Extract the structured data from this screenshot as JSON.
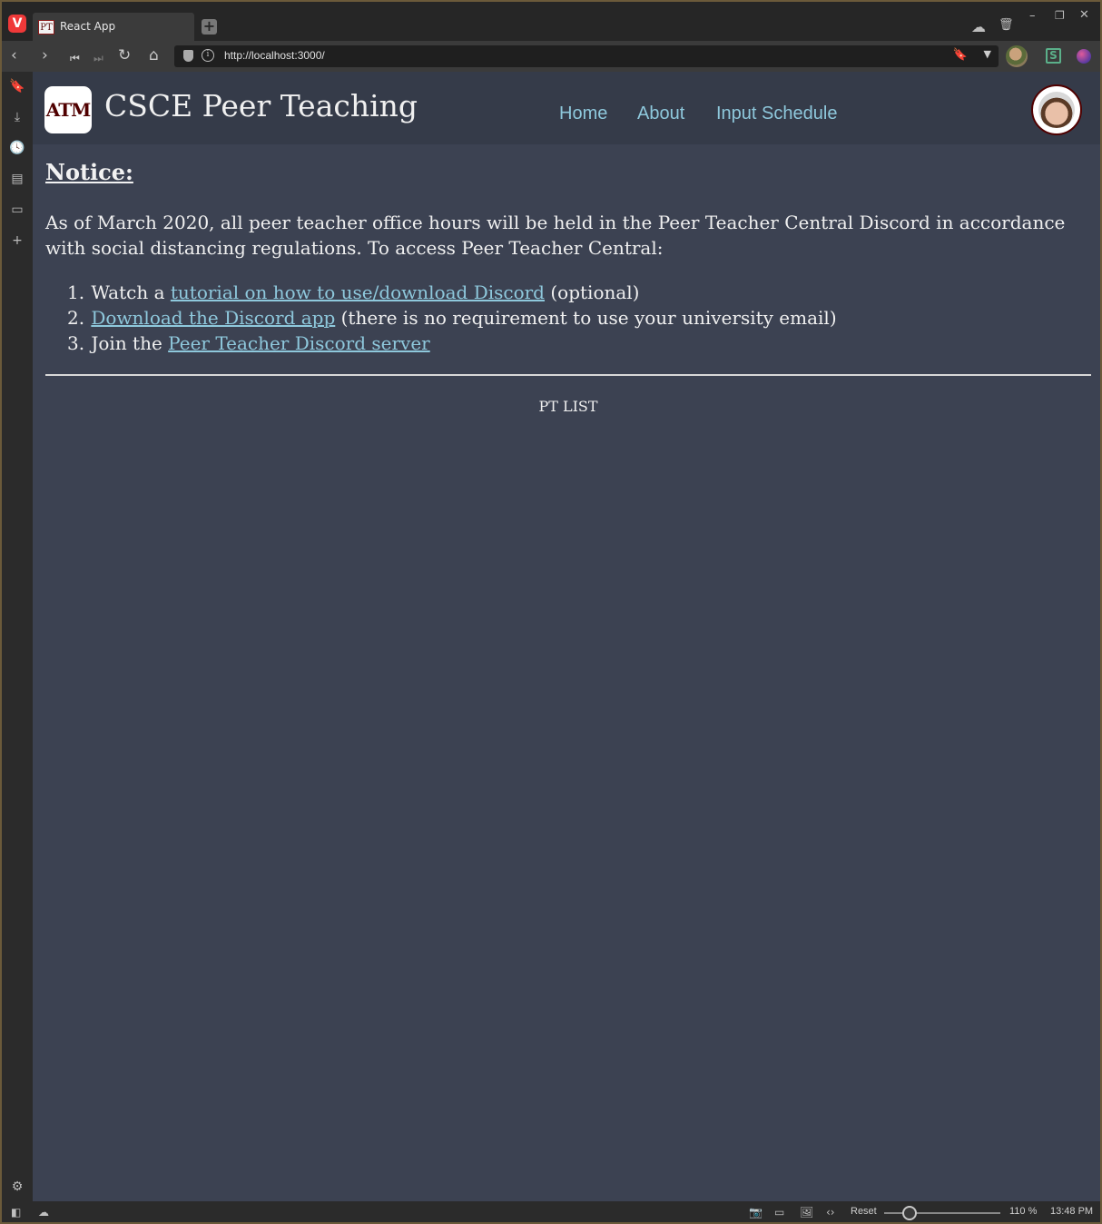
{
  "browser": {
    "tab": {
      "favicon_text": "PT",
      "title": "React App"
    },
    "url": "http://localhost:3000/",
    "status": {
      "reset_label": "Reset",
      "zoom": "110 %",
      "time": "13:48 PM",
      "zoom_fraction": 0.22
    },
    "icons": {
      "logo": "vivaldi-logo-icon",
      "back": "back-arrow-icon",
      "forward": "forward-arrow-icon",
      "rewind": "rewind-icon",
      "fast_forward": "fast-forward-icon",
      "reload": "reload-icon",
      "home": "home-icon",
      "sidepanel": [
        "bookmarks-icon",
        "downloads-icon",
        "history-icon",
        "notes-icon",
        "window-panel-icon",
        "add-panel-icon",
        "settings-icon"
      ]
    }
  },
  "site": {
    "logo_text": "ATM",
    "title": "CSCE Peer Teaching",
    "nav": [
      {
        "label": "Home"
      },
      {
        "label": "About"
      },
      {
        "label": "Input Schedule"
      }
    ],
    "accent_color": "#8ec8dc",
    "brand_color": "#500000"
  },
  "notice": {
    "heading": "Notice:",
    "body": "As of March 2020, all peer teacher office hours will be held in the Peer Teacher Central Discord in accordance with social distancing regulations. To access Peer Teacher Central:",
    "steps": [
      {
        "num": "1.",
        "before": "Watch a ",
        "link": "tutorial on how to use/download Discord",
        "after": " (optional)"
      },
      {
        "num": "2.",
        "before": "",
        "link": "Download the Discord app",
        "after": " (there is no requirement to use your university email)"
      },
      {
        "num": "3.",
        "before": "Join the ",
        "link": "Peer Teacher Discord server",
        "after": ""
      }
    ]
  },
  "pt_list": "PT LIST"
}
